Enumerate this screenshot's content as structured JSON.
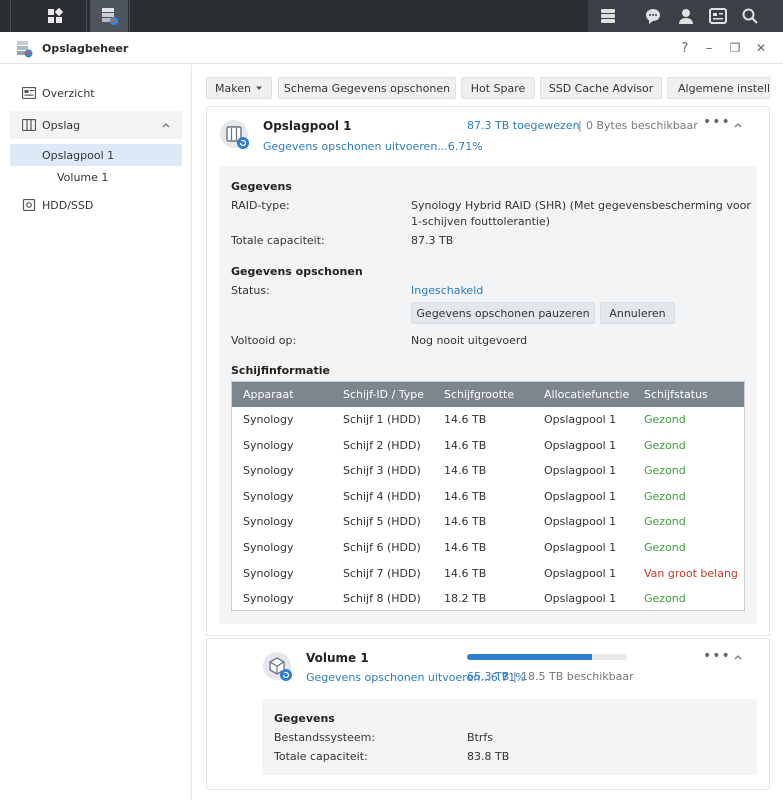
{
  "window": {
    "title": "Opslagbeheer",
    "help": "?",
    "minimize": "–",
    "restore": "❐",
    "close": "✕"
  },
  "colors": {
    "accent": "#2b7bbf",
    "healthy": "#3c9b3c",
    "warning": "#c0392b",
    "taskbar": "#2b2f33"
  },
  "sidebar": {
    "overview": "Overzicht",
    "storage": "Opslag",
    "pool": "Opslagpool 1",
    "volume": "Volume 1",
    "hdd": "HDD/SSD"
  },
  "toolbar": {
    "create": "Maken",
    "scrub_schedule": "Schema Gegevens opschonen",
    "hot_spare": "Hot Spare",
    "ssd_advisor": "SSD Cache Advisor",
    "general": "Algemene instellin"
  },
  "pool": {
    "name": "Opslagpool 1",
    "status_line": "Gegevens opschonen uitvoeren...6.71%",
    "allocated": "87.3 TB toegewezen",
    "separator": "|",
    "available": "0 Bytes beschikbaar",
    "details": {
      "section_data": "Gegevens",
      "raid_label": "RAID-type:",
      "raid_value_line1": "Synology Hybrid RAID (SHR) (Met gegevensbescherming voor",
      "raid_value_line2": "1-schijven fouttolerantie)",
      "capacity_label": "Totale capaciteit:",
      "capacity_value": "87.3 TB",
      "section_scrub": "Gegevens opschonen",
      "status_label": "Status:",
      "status_value": "Ingeschakeld",
      "pause_button": "Gegevens opschonen pauzeren",
      "cancel_button": "Annuleren",
      "completed_label": "Voltooid op:",
      "completed_value": "Nog nooit uitgevoerd",
      "section_disks": "Schijfinformatie"
    }
  },
  "disk_table": {
    "columns": [
      "Apparaat",
      "Schijf-ID / Type",
      "Schijfgrootte",
      "Allocatiefunctie",
      "Schijfstatus"
    ],
    "rows": [
      [
        "Synology",
        "Schijf 1 (HDD)",
        "14.6 TB",
        "Opslagpool 1",
        "Gezond"
      ],
      [
        "Synology",
        "Schijf 2 (HDD)",
        "14.6 TB",
        "Opslagpool 1",
        "Gezond"
      ],
      [
        "Synology",
        "Schijf 3 (HDD)",
        "14.6 TB",
        "Opslagpool 1",
        "Gezond"
      ],
      [
        "Synology",
        "Schijf 4 (HDD)",
        "14.6 TB",
        "Opslagpool 1",
        "Gezond"
      ],
      [
        "Synology",
        "Schijf 5 (HDD)",
        "14.6 TB",
        "Opslagpool 1",
        "Gezond"
      ],
      [
        "Synology",
        "Schijf 6 (HDD)",
        "14.6 TB",
        "Opslagpool 1",
        "Gezond"
      ],
      [
        "Synology",
        "Schijf 7 (HDD)",
        "14.6 TB",
        "Opslagpool 1",
        "Van groot belang"
      ],
      [
        "Synology",
        "Schijf 8 (HDD)",
        "18.2 TB",
        "Opslagpool 1",
        "Gezond"
      ]
    ]
  },
  "volume": {
    "name": "Volume 1",
    "status_line": "Gegevens opschonen uitvoeren...6.71%",
    "used": "65.3 TB",
    "separator": "|",
    "available": "18.5 TB beschikbaar",
    "usage_fraction": 0.78,
    "details": {
      "section_data": "Gegevens",
      "fs_label": "Bestandssysteem:",
      "fs_value": "Btrfs",
      "capacity_label": "Totale capaciteit:",
      "capacity_value": "83.8 TB"
    }
  }
}
